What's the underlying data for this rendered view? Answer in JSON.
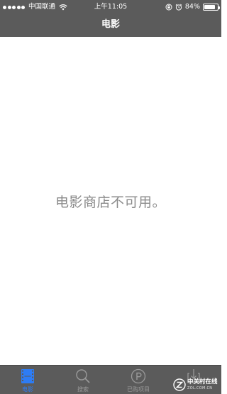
{
  "status_bar": {
    "carrier": "中国联通",
    "time": "上午11:05",
    "battery_percent": "84%",
    "battery_level": 0.84,
    "signal_dots": 5
  },
  "nav": {
    "title": "电影"
  },
  "content": {
    "message": "电影商店不可用。"
  },
  "tabs": [
    {
      "label": "电影",
      "icon": "film-icon",
      "active": true
    },
    {
      "label": "搜索",
      "icon": "search-icon",
      "active": false
    },
    {
      "label": "已购项目",
      "icon": "purchased-icon",
      "active": false
    },
    {
      "label": "",
      "icon": "download-icon",
      "active": false
    }
  ],
  "watermark": {
    "main": "中关村在线",
    "sub": "ZOL.COM.CN"
  },
  "colors": {
    "bar_background": "#5b5b5b",
    "active_tint": "#2d7cf5",
    "inactive_tint": "#9a9a9a",
    "message_text": "#8a8a8a"
  }
}
